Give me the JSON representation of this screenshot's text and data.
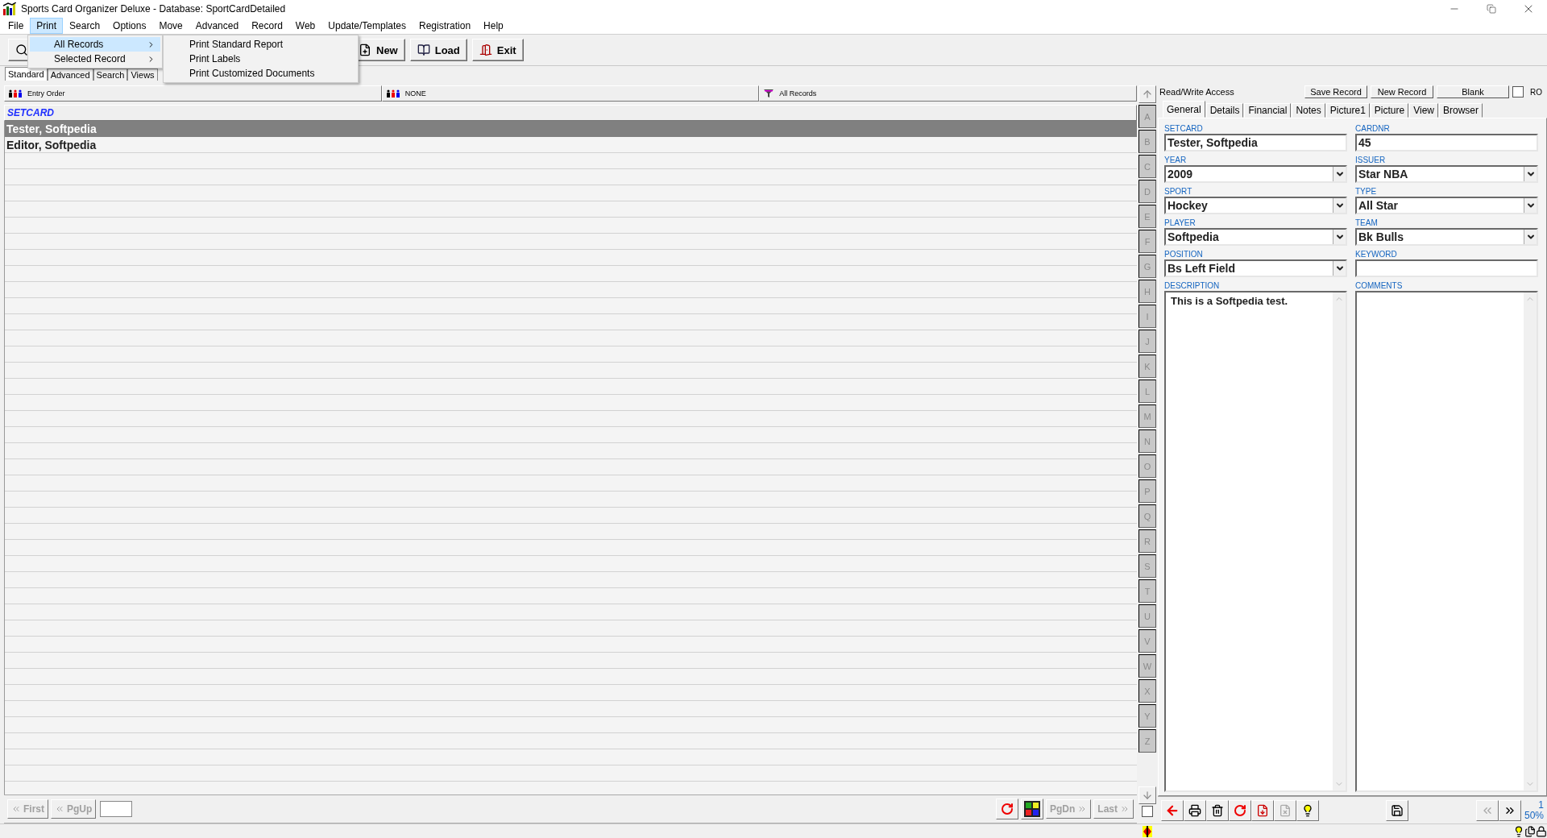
{
  "window": {
    "title": "Sports Card Organizer Deluxe - Database: SportCardDetailed"
  },
  "menu_bar": [
    {
      "label": "File",
      "selected": false
    },
    {
      "label": "Print",
      "selected": true
    },
    {
      "label": "Search",
      "selected": false
    },
    {
      "label": "Options",
      "selected": false
    },
    {
      "label": "Move",
      "selected": false
    },
    {
      "label": "Advanced",
      "selected": false
    },
    {
      "label": "Record",
      "selected": false
    },
    {
      "label": "Web",
      "selected": false
    },
    {
      "label": "Update/Templates",
      "selected": false
    },
    {
      "label": "Registration",
      "selected": false
    },
    {
      "label": "Help",
      "selected": false
    }
  ],
  "open_menu": {
    "items": [
      {
        "label": "All Records",
        "selected": true,
        "submenu": true
      },
      {
        "label": "Selected Record",
        "selected": false,
        "submenu": true
      }
    ],
    "submenu": [
      "Print Standard Report",
      "Print Labels",
      "Print Customized Documents"
    ]
  },
  "toolbar": [
    {
      "label": "New",
      "kind": "new"
    },
    {
      "label": "Load",
      "kind": "load"
    },
    {
      "label": "Exit",
      "kind": "exit"
    }
  ],
  "view_tabs": [
    {
      "label": "Standard",
      "selected": true
    },
    {
      "label": "Advanced",
      "selected": false
    },
    {
      "label": "Search",
      "selected": false
    },
    {
      "label": "Views",
      "selected": false
    }
  ],
  "sort_bar": {
    "order": "Entry Order",
    "filter": "NONE",
    "scope": "All Records"
  },
  "list": {
    "column": "SETCARD",
    "rows": [
      {
        "text": "Tester, Softpedia",
        "selected": true
      },
      {
        "text": "Editor, Softpedia",
        "selected": false
      }
    ]
  },
  "alphabet_check": {
    "checked": false
  },
  "alphabet": [
    "A",
    "B",
    "C",
    "D",
    "E",
    "F",
    "G",
    "H",
    "I",
    "J",
    "K",
    "L",
    "M",
    "N",
    "O",
    "P",
    "Q",
    "R",
    "S",
    "T",
    "U",
    "V",
    "W",
    "X",
    "Y",
    "Z"
  ],
  "nav": {
    "left": [
      {
        "label": "First",
        "disabled": true
      },
      {
        "label": "PgUp",
        "disabled": true
      }
    ],
    "right": [
      {
        "label": "PgDn",
        "disabled": true
      },
      {
        "label": "Last",
        "disabled": true
      }
    ]
  },
  "record": {
    "access": "Read/Write Access",
    "buttons": [
      "Save Record",
      "New Record",
      "Blank"
    ],
    "ro": {
      "label": "RO",
      "checked": false
    },
    "tabs": [
      {
        "label": "General",
        "selected": true
      },
      {
        "label": "Details",
        "selected": false
      },
      {
        "label": "Financial",
        "selected": false
      },
      {
        "label": "Notes",
        "selected": false
      },
      {
        "label": "Picture1",
        "selected": false
      },
      {
        "label": "Picture",
        "selected": false
      },
      {
        "label": "View",
        "selected": false
      },
      {
        "label": "Browser",
        "selected": false
      }
    ],
    "fields": [
      {
        "label": "SETCARD",
        "kind": "text",
        "value": "Tester, Softpedia"
      },
      {
        "label": "CARDNR",
        "kind": "text",
        "value": "45"
      },
      {
        "label": "YEAR",
        "kind": "combo",
        "value": "2009"
      },
      {
        "label": "ISSUER",
        "kind": "combo",
        "value": "Star NBA"
      },
      {
        "label": "SPORT",
        "kind": "combo",
        "value": "Hockey"
      },
      {
        "label": "TYPE",
        "kind": "combo",
        "value": "All Star"
      },
      {
        "label": "PLAYER",
        "kind": "combo",
        "value": "Softpedia"
      },
      {
        "label": "TEAM",
        "kind": "combo",
        "value": "Bk Bulls"
      },
      {
        "label": "POSITION",
        "kind": "combo",
        "value": "Bs Left Field"
      },
      {
        "label": "KEYWORD",
        "kind": "text"
      },
      {
        "label": "DESCRIPTION",
        "kind": "memo",
        "value": "This is a Softpedia test."
      },
      {
        "label": "COMMENTS",
        "kind": "memo"
      }
    ],
    "record_number": "1",
    "zoom": "50%"
  }
}
